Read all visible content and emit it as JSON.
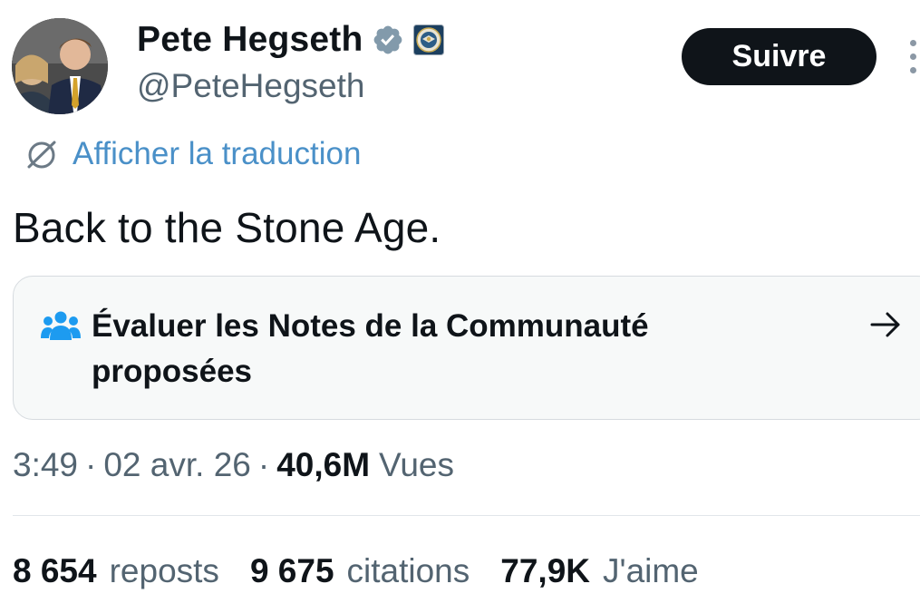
{
  "author": {
    "display_name": "Pete Hegseth",
    "handle": "@PeteHegseth",
    "verified_icon": "verified-badge-icon",
    "affiliation_icon": "affiliation-seal-icon"
  },
  "actions": {
    "follow_label": "Suivre",
    "more_icon": "more-vertical-icon"
  },
  "translation": {
    "label": "Afficher la traduction",
    "icon": "translate-globe-icon"
  },
  "tweet": {
    "text": "Back to the Stone Age."
  },
  "community_notes": {
    "icon": "people-icon",
    "label": "Évaluer les Notes de la Communauté proposées",
    "arrow_icon": "arrow-right-icon"
  },
  "meta": {
    "time": "3:49",
    "separator": "·",
    "date": "02 avr. 26",
    "views_count": "40,6M",
    "views_label": "Vues"
  },
  "stats": [
    {
      "count": "8 654",
      "label": "reposts"
    },
    {
      "count": "9 675",
      "label": "citations"
    },
    {
      "count": "77,9K",
      "label": "J'aime"
    }
  ],
  "colors": {
    "text_primary": "#0f1419",
    "text_secondary": "#536471",
    "link_blue": "#4a90c8",
    "verified_gray": "#829aab",
    "notes_blue": "#1d9bf0",
    "card_bg": "#f7f9f9",
    "button_bg": "#0f1419"
  }
}
